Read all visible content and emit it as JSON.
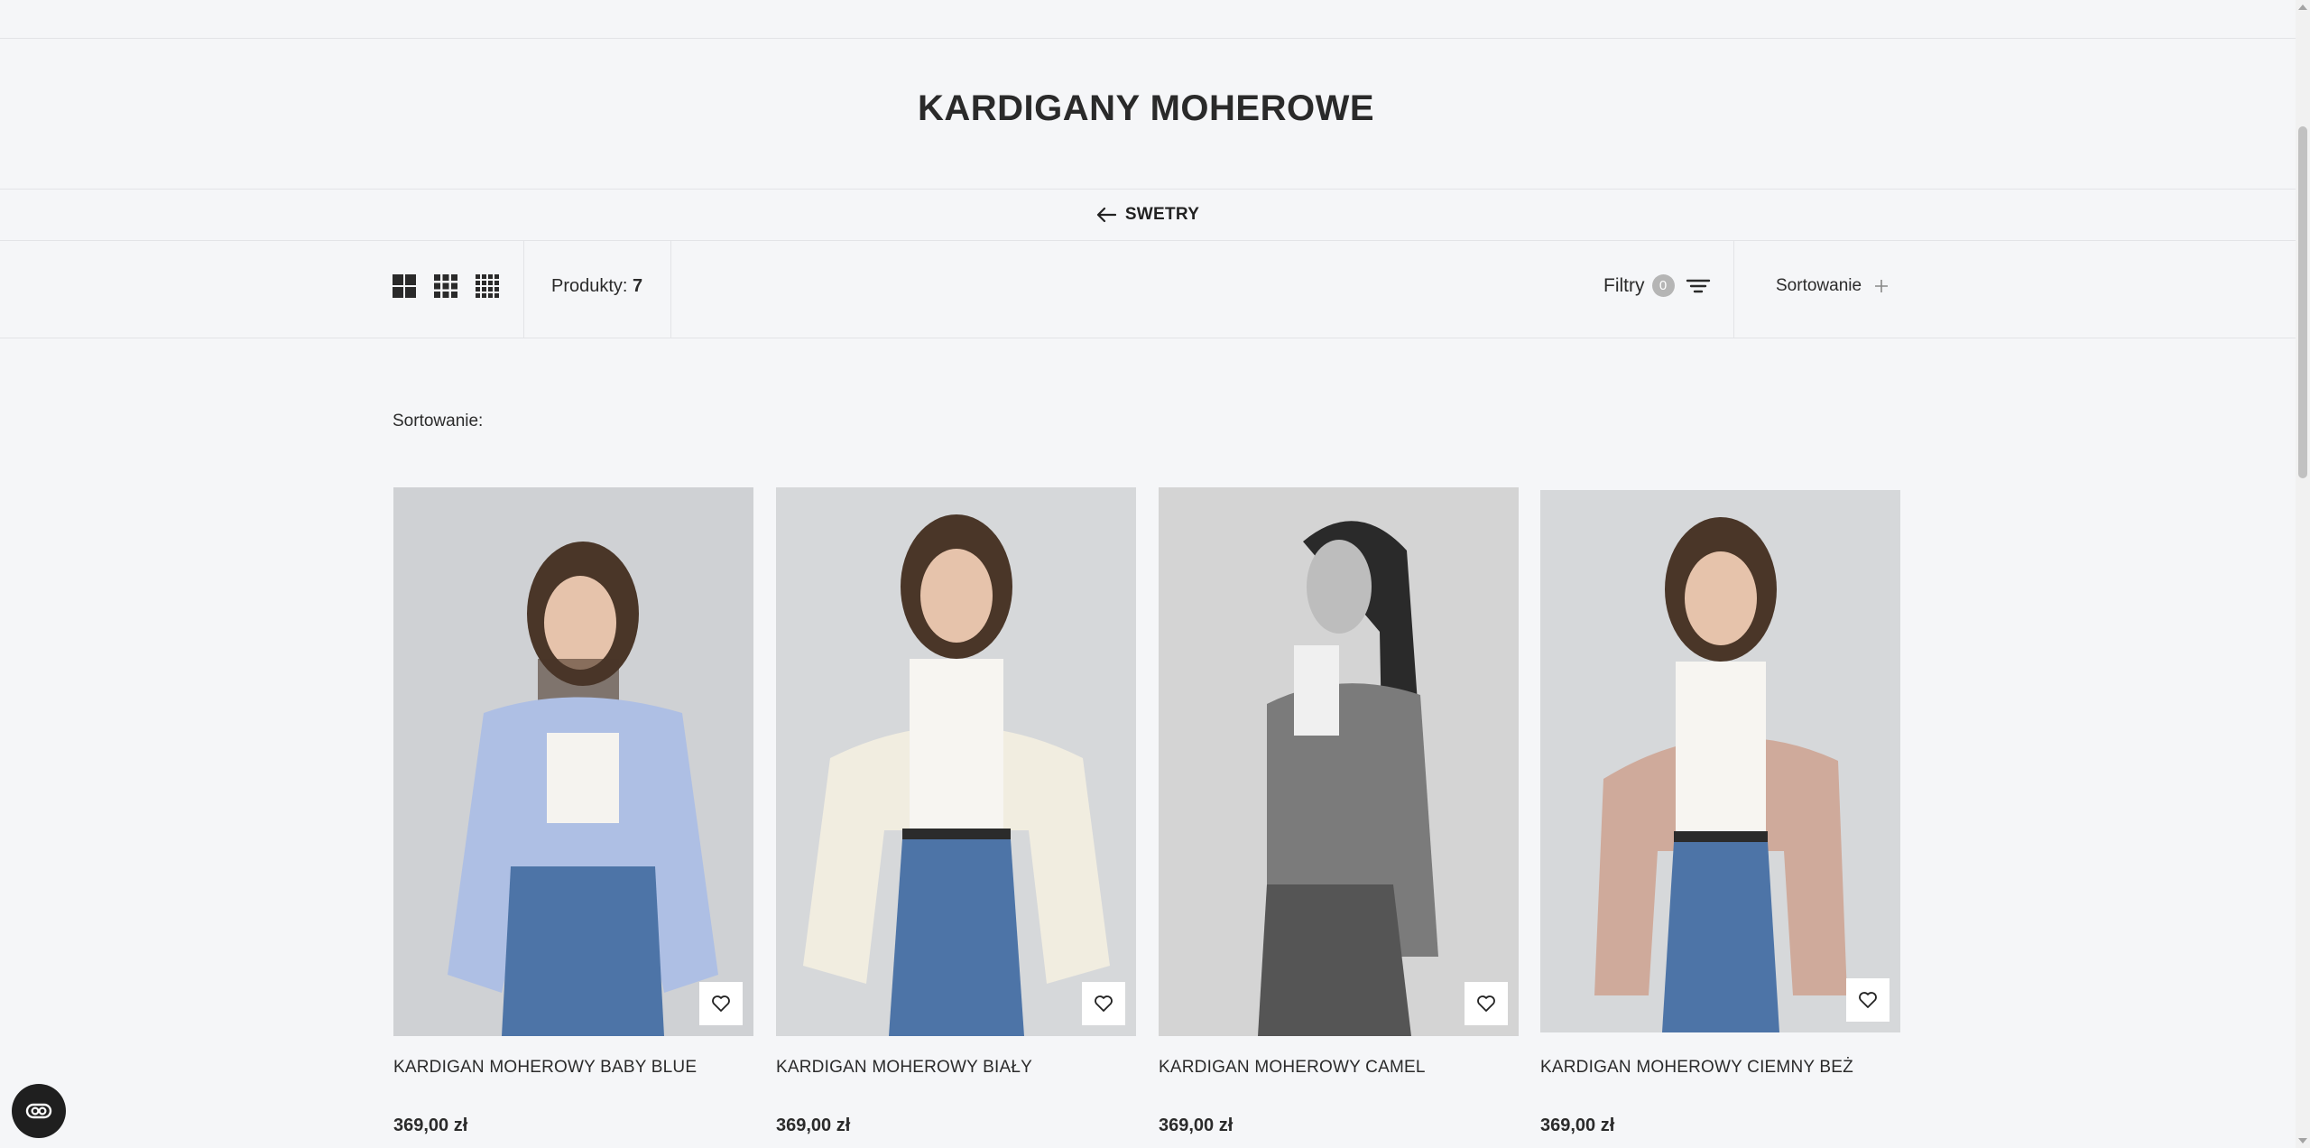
{
  "category": {
    "title": "KARDIGANY MOHEROWE",
    "back_label": "SWETRY"
  },
  "toolbar": {
    "grid_options": [
      "grid-2-icon",
      "grid-3-icon",
      "grid-4-icon"
    ],
    "products_label": "Produkty:",
    "products_count": "7",
    "filters_label": "Filtry",
    "filters_count": "0",
    "sort_label": "Sortowanie"
  },
  "sort_caption": "Sortowanie:",
  "products": [
    {
      "name": "KARDIGAN MOHEROWY BABY BLUE",
      "price": "369,00 zł",
      "sweater_color": "#aebfe4"
    },
    {
      "name": "KARDIGAN MOHEROWY BIAŁY",
      "price": "369,00 zł",
      "sweater_color": "#f1ede0"
    },
    {
      "name": "KARDIGAN MOHEROWY CAMEL",
      "price": "369,00 zł",
      "sweater_color": "#7b7b7b"
    },
    {
      "name": "KARDIGAN MOHEROWY CIEMNY BEŻ",
      "price": "369,00 zł",
      "sweater_color": "#cfaa9b"
    }
  ],
  "colors": {
    "background": "#f5f6f8",
    "text": "#2b2b2b",
    "badge": "#b5b5b5",
    "accessibility_button": "#1f1f1f"
  }
}
